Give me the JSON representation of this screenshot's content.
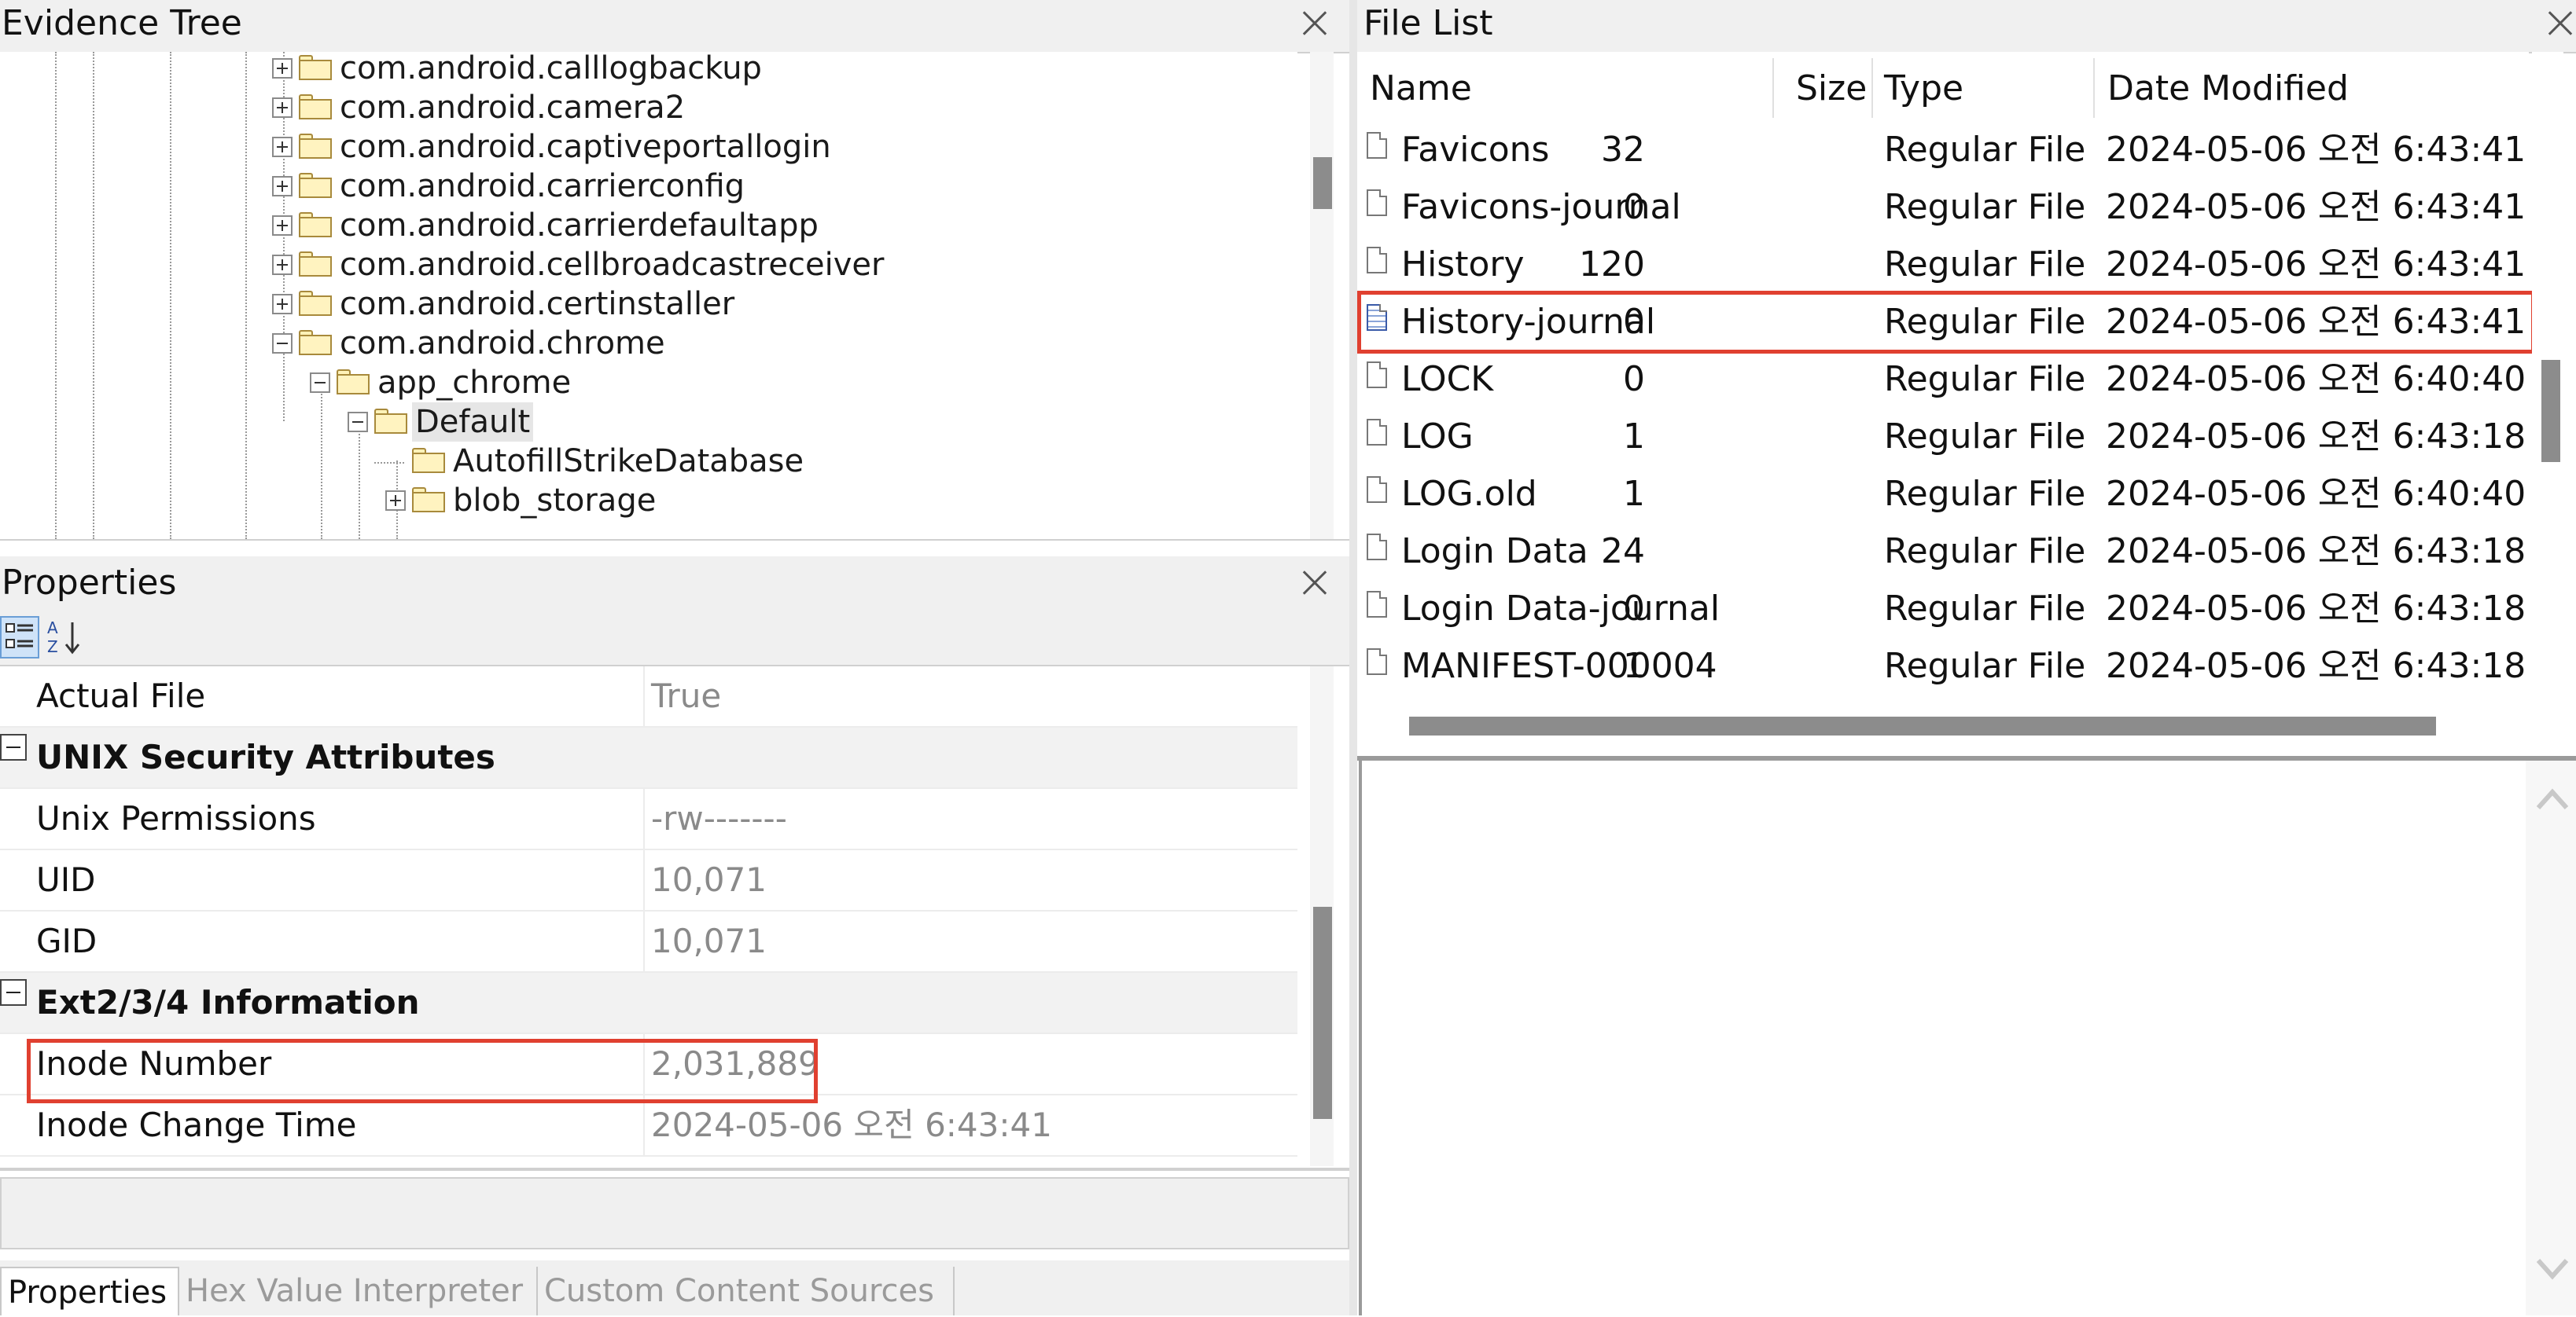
{
  "evidence_tree": {
    "title": "Evidence Tree",
    "nodes": [
      {
        "label": "com.android.calllogbackup",
        "toggle": "plus",
        "selected": false
      },
      {
        "label": "com.android.camera2",
        "toggle": "plus",
        "selected": false
      },
      {
        "label": "com.android.captiveportallogin",
        "toggle": "plus",
        "selected": false
      },
      {
        "label": "com.android.carrierconfig",
        "toggle": "plus",
        "selected": false
      },
      {
        "label": "com.android.carrierdefaultapp",
        "toggle": "plus",
        "selected": false
      },
      {
        "label": "com.android.cellbroadcastreceiver",
        "toggle": "plus",
        "selected": false
      },
      {
        "label": "com.android.certinstaller",
        "toggle": "plus",
        "selected": false
      },
      {
        "label": "com.android.chrome",
        "toggle": "minus",
        "selected": false
      },
      {
        "label": "app_chrome",
        "toggle": "minus",
        "selected": false
      },
      {
        "label": "Default",
        "toggle": "minus",
        "selected": true
      },
      {
        "label": "AutofillStrikeDatabase",
        "toggle": "none",
        "selected": false
      },
      {
        "label": "blob_storage",
        "toggle": "plus",
        "selected": false
      }
    ]
  },
  "properties": {
    "title": "Properties",
    "toolbar": {
      "categorized_icon": "categorized-view-icon",
      "alphabetical_icon": "sort-az-icon"
    },
    "rows": [
      {
        "kind": "prop",
        "name": "Actual File",
        "value": "True"
      },
      {
        "kind": "group",
        "name": "UNIX Security Attributes"
      },
      {
        "kind": "prop",
        "name": "Unix Permissions",
        "value": "-rw-------"
      },
      {
        "kind": "prop",
        "name": "UID",
        "value": "10,071"
      },
      {
        "kind": "prop",
        "name": "GID",
        "value": "10,071"
      },
      {
        "kind": "group",
        "name": "Ext2/3/4 Information"
      },
      {
        "kind": "prop",
        "name": "Inode Number",
        "value": "2,031,889",
        "highlighted": true
      },
      {
        "kind": "prop",
        "name": "Inode Change Time",
        "value": "2024-05-06 오전 6:43:41"
      }
    ]
  },
  "bottom_tabs": [
    {
      "label": "Properties",
      "active": true
    },
    {
      "label": "Hex Value Interpreter",
      "active": false
    },
    {
      "label": "Custom Content Sources",
      "active": false
    }
  ],
  "file_list": {
    "title": "File List",
    "columns": {
      "name": "Name",
      "size": "Size",
      "type": "Type",
      "date": "Date Modified"
    },
    "rows": [
      {
        "name": "Favicons",
        "size": "32",
        "type": "Regular File",
        "date": "2024-05-06 오전 6:43:41"
      },
      {
        "name": "Favicons-journal",
        "size": "0",
        "type": "Regular File",
        "date": "2024-05-06 오전 6:43:41"
      },
      {
        "name": "History",
        "size": "120",
        "type": "Regular File",
        "date": "2024-05-06 오전 6:43:41"
      },
      {
        "name": "History-journal",
        "size": "0",
        "type": "Regular File",
        "date": "2024-05-06 오전 6:43:41",
        "highlighted": true,
        "special_icon": true
      },
      {
        "name": "LOCK",
        "size": "0",
        "type": "Regular File",
        "date": "2024-05-06 오전 6:40:40"
      },
      {
        "name": "LOG",
        "size": "1",
        "type": "Regular File",
        "date": "2024-05-06 오전 6:43:18"
      },
      {
        "name": "LOG.old",
        "size": "1",
        "type": "Regular File",
        "date": "2024-05-06 오전 6:40:40"
      },
      {
        "name": "Login Data",
        "size": "24",
        "type": "Regular File",
        "date": "2024-05-06 오전 6:43:18"
      },
      {
        "name": "Login Data-journal",
        "size": "0",
        "type": "Regular File",
        "date": "2024-05-06 오전 6:43:18"
      },
      {
        "name": "MANIFEST-000004",
        "size": "1",
        "type": "Regular File",
        "date": "2024-05-06 오전 6:43:18"
      }
    ]
  },
  "colors": {
    "highlight": "#e04030",
    "folder": "#fff3c0",
    "panel_header": "#f0f0f0"
  }
}
